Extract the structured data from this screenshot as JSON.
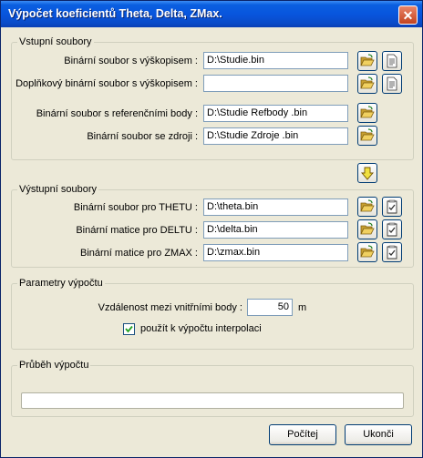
{
  "window": {
    "title": "Výpočet koeficientů Theta, Delta, ZMax.",
    "close_glyph": "✕"
  },
  "input_group": {
    "legend": "Vstupní soubory",
    "rows": [
      {
        "label": "Binární soubor s výškopisem :",
        "value": "D:\\Studie.bin"
      },
      {
        "label": "Doplňkový binární soubor s výškopisem :",
        "value": ""
      },
      {
        "label": "Binární soubor s referenčními body :",
        "value": "D:\\Studie Refbody .bin"
      },
      {
        "label": "Binární soubor se zdroji :",
        "value": "D:\\Studie Zdroje .bin"
      }
    ]
  },
  "output_group": {
    "legend": "Výstupní soubory",
    "rows": [
      {
        "label": "Binární soubor pro THETU :",
        "value": "D:\\theta.bin"
      },
      {
        "label": "Binární matice pro DELTU :",
        "value": "D:\\delta.bin"
      },
      {
        "label": "Binární matice pro ZMAX :",
        "value": "D:\\zmax.bin"
      }
    ]
  },
  "params_group": {
    "legend": "Parametry výpočtu",
    "distance_label": "Vzdálenost mezi vnitřními body :",
    "distance_value": "50",
    "distance_unit": "m",
    "interp_label": "použít k výpočtu interpolaci",
    "interp_checked": true
  },
  "progress_group": {
    "legend": "Průběh výpočtu",
    "progress": 0
  },
  "buttons": {
    "compute": "Počítej",
    "close": "Ukonči"
  },
  "icons": {
    "folder": "folder-open-icon",
    "document": "document-icon",
    "arrow": "arrow-down-icon",
    "checklist": "checklist-icon"
  },
  "colors": {
    "title_bar": "#0855dd",
    "dialog_bg": "#ece9d8",
    "field_border": "#7f9db9"
  }
}
